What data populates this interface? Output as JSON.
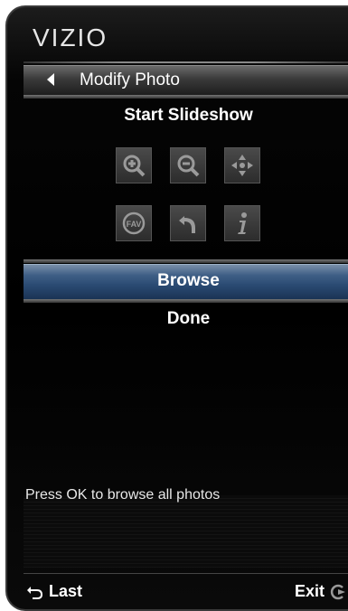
{
  "brand": "VIZIO",
  "header": {
    "title": "Modify Photo"
  },
  "menu": {
    "start_slideshow": "Start Slideshow",
    "browse": "Browse",
    "done": "Done"
  },
  "icons": {
    "row1": [
      "zoom-in-icon",
      "zoom-out-icon",
      "pan-move-icon"
    ],
    "row2": [
      "favorite-icon",
      "rotate-icon",
      "info-icon"
    ]
  },
  "hint": "Press OK to browse all photos",
  "footer": {
    "last": "Last",
    "exit": "Exit"
  },
  "colors": {
    "highlight": "#3f5f86",
    "icon_gray": "#9a9a9a"
  }
}
